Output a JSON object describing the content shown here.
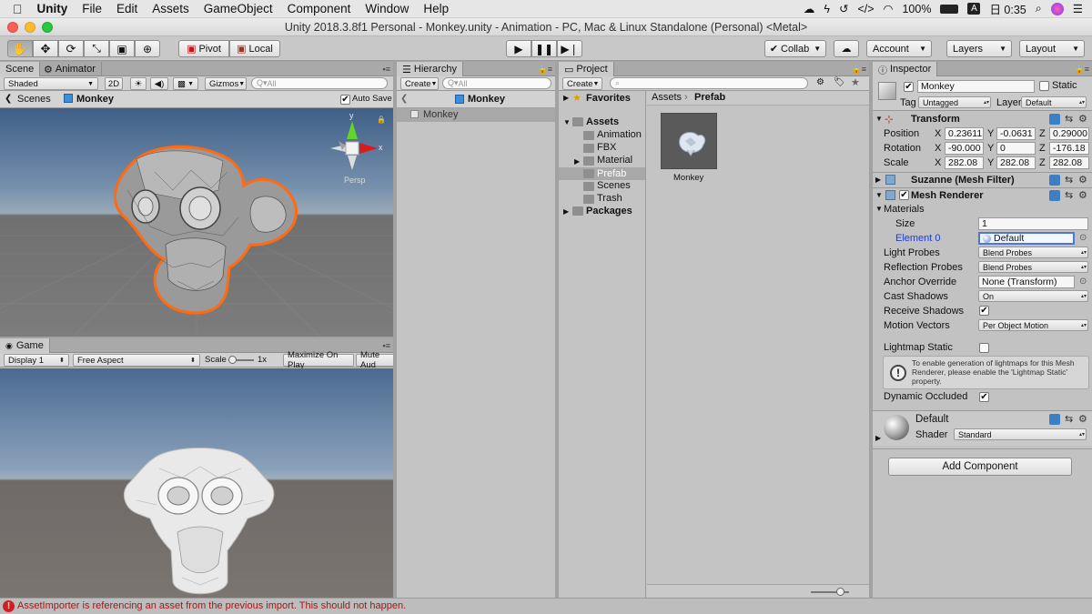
{
  "macmenu": {
    "items": [
      "Unity",
      "File",
      "Edit",
      "Assets",
      "GameObject",
      "Component",
      "Window",
      "Help"
    ],
    "battery": "100%",
    "clock": "日 0:35"
  },
  "window": {
    "title": "Unity 2018.3.8f1 Personal - Monkey.unity - Animation - PC, Mac & Linux Standalone (Personal) <Metal>"
  },
  "toolbar": {
    "pivot": "Pivot",
    "local": "Local",
    "collab": "Collab",
    "account": "Account",
    "layers": "Layers",
    "layout": "Layout"
  },
  "scene": {
    "tabs": [
      "Scene",
      "Animator"
    ],
    "shading": "Shaded",
    "mode_2d": "2D",
    "gizmos": "Gizmos",
    "search_placeholder": "All",
    "breadcrumb_scenes": "Scenes",
    "breadcrumb_object": "Monkey",
    "autosave": "Auto Save",
    "persp": "Persp",
    "axis_y": "y",
    "axis_x": "x"
  },
  "game": {
    "tab": "Game",
    "display": "Display 1",
    "aspect": "Free Aspect",
    "scale_label": "Scale",
    "scale_value": "1x",
    "maximize": "Maximize On Play",
    "mute": "Mute Aud"
  },
  "hierarchy": {
    "tab": "Hierarchy",
    "create": "Create",
    "search_placeholder": "All",
    "title": "Monkey",
    "items": [
      "Monkey"
    ]
  },
  "project": {
    "tab": "Project",
    "create": "Create",
    "favorites": "Favorites",
    "assets": "Assets",
    "folders": [
      "Animation",
      "FBX",
      "Material",
      "Prefab",
      "Scenes",
      "Trash"
    ],
    "packages": "Packages",
    "breadcrumb": [
      "Assets",
      "Prefab"
    ],
    "asset_name": "Monkey"
  },
  "inspector": {
    "tab": "Inspector",
    "object_name": "Monkey",
    "static_label": "Static",
    "tag_label": "Tag",
    "tag_value": "Untagged",
    "layer_label": "Layer",
    "layer_value": "Default",
    "transform": {
      "title": "Transform",
      "position_label": "Position",
      "position": {
        "x": "0.23611",
        "y": "-0.0631",
        "z": "0.29000"
      },
      "rotation_label": "Rotation",
      "rotation": {
        "x": "-90.000",
        "y": "0",
        "z": "-176.18"
      },
      "scale_label": "Scale",
      "scale": {
        "x": "282.08",
        "y": "282.08",
        "z": "282.08"
      },
      "axis_x": "X",
      "axis_y": "Y",
      "axis_z": "Z"
    },
    "mesh_filter": {
      "title": "Suzanne (Mesh Filter)"
    },
    "mesh_renderer": {
      "title": "Mesh Renderer",
      "materials": "Materials",
      "size_label": "Size",
      "size_value": "1",
      "element0_label": "Element 0",
      "element0_value": "Default",
      "light_probes_label": "Light Probes",
      "light_probes_value": "Blend Probes",
      "reflection_probes_label": "Reflection Probes",
      "reflection_probes_value": "Blend Probes",
      "anchor_override_label": "Anchor Override",
      "anchor_override_value": "None (Transform)",
      "cast_shadows_label": "Cast Shadows",
      "cast_shadows_value": "On",
      "receive_shadows_label": "Receive Shadows",
      "motion_vectors_label": "Motion Vectors",
      "motion_vectors_value": "Per Object Motion",
      "lightmap_static_label": "Lightmap Static",
      "info_text": "To enable generation of lightmaps for this Mesh Renderer, please enable the 'Lightmap Static' property.",
      "dynamic_occluded_label": "Dynamic Occluded"
    },
    "material": {
      "name": "Default",
      "shader_label": "Shader",
      "shader_value": "Standard"
    },
    "add_component": "Add Component"
  },
  "status": {
    "message": "AssetImporter is referencing an asset from the previous import. This should not happen."
  },
  "colors": {
    "selection_outline": "#ff6a12",
    "status_error": "#a31818",
    "element_link": "#1c3ddb"
  }
}
